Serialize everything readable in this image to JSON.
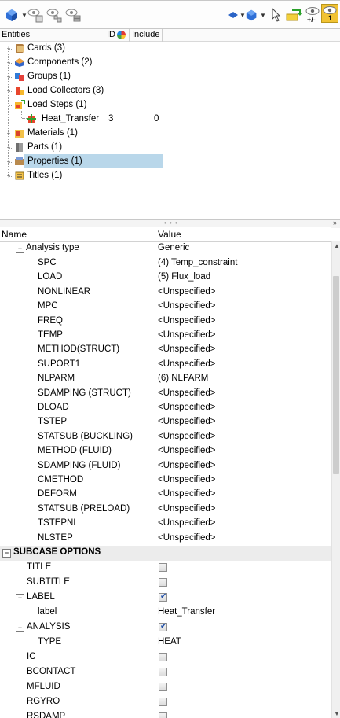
{
  "toolbar": {
    "left_icons": [
      "entity-selector-icon",
      "show-elements-icon",
      "show-by-id-icon",
      "show-config-icon"
    ],
    "right_icons": [
      "display-mode-icon",
      "entity-display-icon",
      "select-cursor-icon",
      "export-icon",
      "isolate-plus-minus-icon",
      "isolate-only-icon"
    ],
    "isolate_label": "+/-",
    "badge_label": "1"
  },
  "entities_header": {
    "entities": "Entities",
    "id": "ID",
    "include": "Include"
  },
  "tree": [
    {
      "label": "Cards (3)",
      "icon": "cards-icon"
    },
    {
      "label": "Components (2)",
      "icon": "components-icon"
    },
    {
      "label": "Groups (1)",
      "icon": "groups-icon"
    },
    {
      "label": "Load Collectors (3)",
      "icon": "load-collectors-icon"
    },
    {
      "label": "Load Steps (1)",
      "icon": "load-steps-icon"
    },
    {
      "label": "Heat_Transfer",
      "id": "3",
      "include": "0",
      "icon": "load-step-item-icon",
      "selected": true
    },
    {
      "label": "Materials (1)",
      "icon": "materials-icon"
    },
    {
      "label": "Parts (1)",
      "icon": "parts-icon"
    },
    {
      "label": "Properties (1)",
      "icon": "properties-icon"
    },
    {
      "label": "Titles (1)",
      "icon": "titles-icon"
    }
  ],
  "splitter": {
    "dots": "• • •",
    "collapse": "»"
  },
  "props_header": {
    "name": "Name",
    "value": "Value"
  },
  "props": {
    "analysis_type": {
      "name": "Analysis type",
      "value": "Generic"
    },
    "analysis_rows": [
      {
        "name": "SPC",
        "value": "(4) Temp_constraint"
      },
      {
        "name": "LOAD",
        "value": "(5) Flux_load"
      },
      {
        "name": "NONLINEAR",
        "value": "<Unspecified>"
      },
      {
        "name": "MPC",
        "value": "<Unspecified>"
      },
      {
        "name": "FREQ",
        "value": "<Unspecified>"
      },
      {
        "name": "TEMP",
        "value": "<Unspecified>"
      },
      {
        "name": "METHOD(STRUCT)",
        "value": "<Unspecified>"
      },
      {
        "name": "SUPORT1",
        "value": "<Unspecified>"
      },
      {
        "name": "NLPARM",
        "value": "(6) NLPARM"
      },
      {
        "name": "SDAMPING (STRUCT)",
        "value": "<Unspecified>"
      },
      {
        "name": "DLOAD",
        "value": "<Unspecified>"
      },
      {
        "name": "TSTEP",
        "value": "<Unspecified>"
      },
      {
        "name": "STATSUB (BUCKLING)",
        "value": "<Unspecified>"
      },
      {
        "name": "METHOD (FLUID)",
        "value": "<Unspecified>"
      },
      {
        "name": "SDAMPING (FLUID)",
        "value": "<Unspecified>"
      },
      {
        "name": "CMETHOD",
        "value": "<Unspecified>"
      },
      {
        "name": "DEFORM",
        "value": "<Unspecified>"
      },
      {
        "name": "STATSUB (PRELOAD)",
        "value": "<Unspecified>"
      },
      {
        "name": "TSTEPNL",
        "value": "<Unspecified>"
      },
      {
        "name": "NLSTEP",
        "value": "<Unspecified>"
      }
    ],
    "subcase_header": "SUBCASE OPTIONS",
    "title": {
      "name": "TITLE",
      "checked": false
    },
    "subtitle": {
      "name": "SUBTITLE",
      "checked": false
    },
    "label": {
      "name": "LABEL",
      "checked": true
    },
    "label_value": {
      "name": "label",
      "value": "Heat_Transfer"
    },
    "analysis": {
      "name": "ANALYSIS",
      "checked": true
    },
    "analysis_type_value": {
      "name": "TYPE",
      "value": "HEAT"
    },
    "tail_rows": [
      {
        "name": "IC",
        "checked": false
      },
      {
        "name": "BCONTACT",
        "checked": false
      },
      {
        "name": "MFLUID",
        "checked": false
      },
      {
        "name": "RGYRO",
        "checked": false
      },
      {
        "name": "RSDAMP",
        "checked": false
      }
    ]
  },
  "colors": {
    "selection": "#b9d7ea",
    "group_header": "#ececec",
    "check": "#1f4fa8"
  }
}
